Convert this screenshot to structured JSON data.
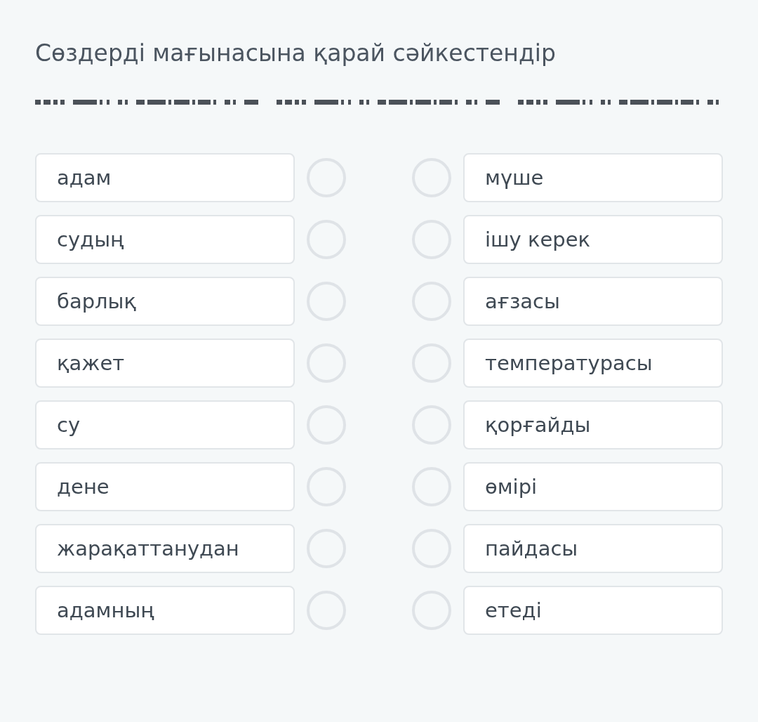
{
  "title": "Сөздерді мағынасына қарай сәйкестендір",
  "left": [
    "адам",
    "судың",
    "барлық",
    "қажет",
    "су",
    "дене",
    "жарақаттанудан",
    "адамның"
  ],
  "right": [
    "мүше",
    "ішу керек",
    "ағзасы",
    "температурасы",
    "қорғайды",
    "өмірі",
    "пайдасы",
    "етеді"
  ]
}
